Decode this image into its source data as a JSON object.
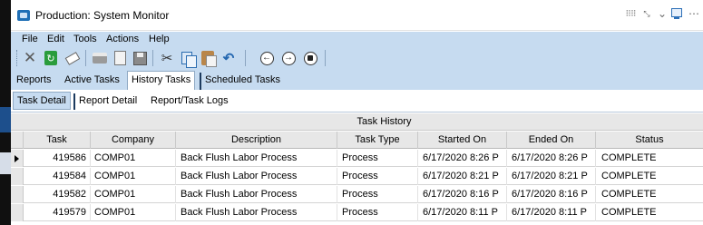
{
  "window": {
    "title": "Production: System Monitor"
  },
  "menu": [
    "File",
    "Edit",
    "Tools",
    "Actions",
    "Help"
  ],
  "toolbar_icons": [
    "close-icon",
    "refresh-icon",
    "clear-icon",
    "print-icon",
    "print-preview-icon",
    "save-icon",
    "cut-icon",
    "copy-icon",
    "paste-icon",
    "undo-icon",
    "back-icon",
    "forward-icon",
    "home-icon"
  ],
  "tabs": [
    {
      "label": "Reports",
      "active": false
    },
    {
      "label": "Active Tasks",
      "active": false
    },
    {
      "label": "History Tasks",
      "active": true
    },
    {
      "label": "Scheduled Tasks",
      "active": false
    }
  ],
  "subtabs": [
    {
      "label": "Task Detail",
      "active": true
    },
    {
      "label": "Report Detail",
      "active": false
    },
    {
      "label": "Report/Task Logs",
      "active": false
    }
  ],
  "grid": {
    "caption": "Task History",
    "columns": [
      "Task",
      "Company",
      "Description",
      "Task Type",
      "Started On",
      "Ended On",
      "Status"
    ],
    "rows": [
      {
        "task": "419586",
        "company": "COMP01",
        "description": "Back Flush Labor Process",
        "type": "Process",
        "started": "6/17/2020 8:26 P",
        "ended": "6/17/2020 8:26 P",
        "status": "COMPLETE",
        "current": true
      },
      {
        "task": "419584",
        "company": "COMP01",
        "description": "Back Flush Labor Process",
        "type": "Process",
        "started": "6/17/2020 8:21 P",
        "ended": "6/17/2020 8:21 P",
        "status": "COMPLETE",
        "current": false
      },
      {
        "task": "419582",
        "company": "COMP01",
        "description": "Back Flush Labor Process",
        "type": "Process",
        "started": "6/17/2020 8:16 P",
        "ended": "6/17/2020 8:16 P",
        "status": "COMPLETE",
        "current": false
      },
      {
        "task": "419579",
        "company": "COMP01",
        "description": "Back Flush Labor Process",
        "type": "Process",
        "started": "6/17/2020 8:11 P",
        "ended": "6/17/2020 8:11 P",
        "status": "COMPLETE",
        "current": false
      }
    ]
  },
  "colors": {
    "chrome": "#c6dbf0",
    "grid_header": "#e7e7e7",
    "accent": "#1f6fb6"
  }
}
